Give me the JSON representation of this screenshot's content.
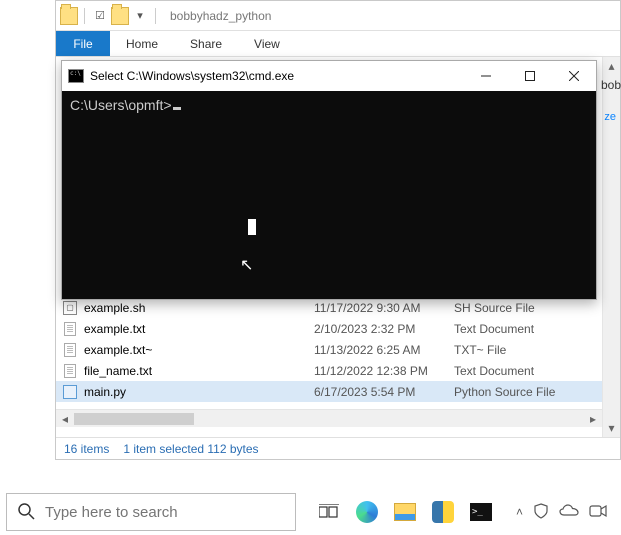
{
  "explorer": {
    "title": "bobbyhadz_python",
    "tabs": {
      "file": "File",
      "home": "Home",
      "share": "Share",
      "view": "View"
    },
    "side_chip": "ze",
    "files": [
      {
        "name": "example.sh",
        "date": "11/17/2022 9:30 AM",
        "type": "SH Source File",
        "icon": "sh"
      },
      {
        "name": "example.txt",
        "date": "2/10/2023 2:32 PM",
        "type": "Text Document",
        "icon": "txt"
      },
      {
        "name": "example.txt~",
        "date": "11/13/2022 6:25 AM",
        "type": "TXT~ File",
        "icon": "txt"
      },
      {
        "name": "file_name.txt",
        "date": "11/12/2022 12:38 PM",
        "type": "Text Document",
        "icon": "txt"
      },
      {
        "name": "main.py",
        "date": "6/17/2023 5:54 PM",
        "type": "Python Source File",
        "icon": "py",
        "selected": true
      }
    ],
    "status": {
      "count": "16 items",
      "selection": "1 item selected  112 bytes"
    }
  },
  "cmd": {
    "title": "Select C:\\Windows\\system32\\cmd.exe",
    "prompt": "C:\\Users\\opmft>"
  },
  "right_clip": "bob",
  "taskbar": {
    "search_placeholder": "Type here to search",
    "term_glyph": ">_"
  }
}
